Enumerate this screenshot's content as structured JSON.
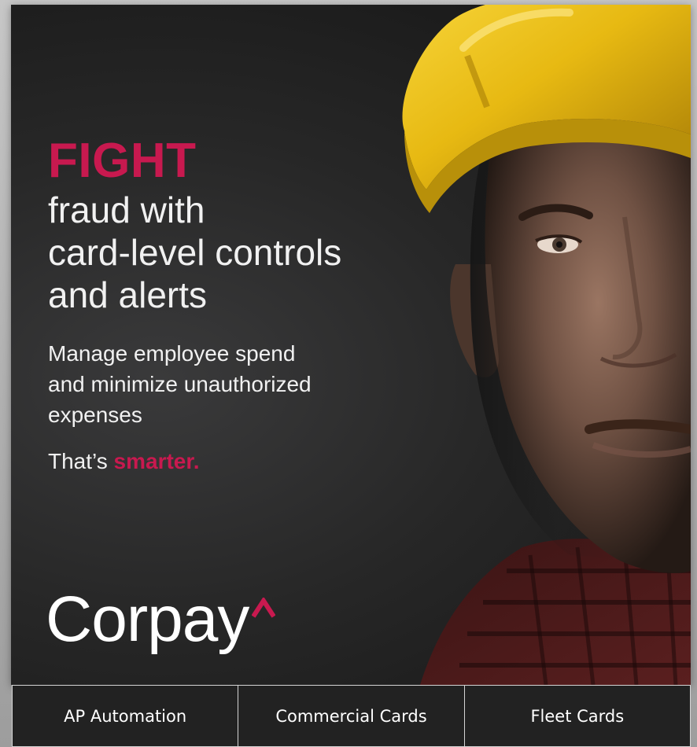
{
  "ad": {
    "headline_accent": "FIGHT",
    "headline_lines": [
      "fraud with",
      "card-level controls",
      "and alerts"
    ],
    "body_lines": [
      "Manage employee spend",
      "and minimize unauthorized",
      "expenses"
    ],
    "tagline_prefix": "That’s ",
    "tagline_accent": "smarter.",
    "brand": "Corpay",
    "accent_color": "#c8194f",
    "background_color": "#272727",
    "photo_icon": "construction-worker-photo",
    "logo_icon": "corpay-caret-icon"
  },
  "nav": {
    "items": [
      {
        "label": "AP Automation"
      },
      {
        "label": "Commercial Cards"
      },
      {
        "label": "Fleet Cards"
      }
    ]
  }
}
